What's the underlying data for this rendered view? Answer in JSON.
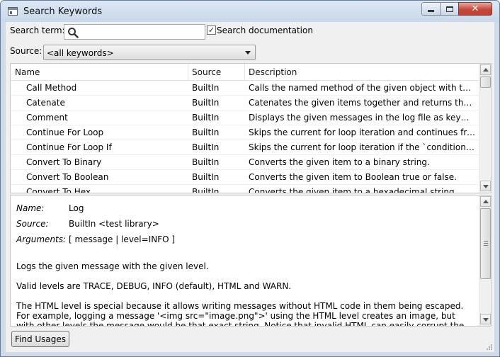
{
  "window": {
    "title": "Search Keywords"
  },
  "search": {
    "term_label": "Search term:",
    "term_value": "",
    "search_docs_label": "Search documentation",
    "search_docs_checked": true,
    "source_label": "Source:",
    "source_value": "<all keywords>"
  },
  "table": {
    "columns": [
      "Name",
      "Source",
      "Description"
    ],
    "rows": [
      {
        "name": "Call Method",
        "source": "BuiltIn",
        "description": "Calls the named method of the given object with the ..."
      },
      {
        "name": "Catenate",
        "source": "BuiltIn",
        "description": "Catenates the given items together and returns the r..."
      },
      {
        "name": "Comment",
        "source": "BuiltIn",
        "description": "Displays the given messages in the log file as keywor..."
      },
      {
        "name": "Continue For Loop",
        "source": "BuiltIn",
        "description": "Skips the current for loop iteration and continues fro..."
      },
      {
        "name": "Continue For Loop If",
        "source": "BuiltIn",
        "description": "Skips the current for loop iteration if the `condition` i..."
      },
      {
        "name": "Convert To Binary",
        "source": "BuiltIn",
        "description": "Converts the given item to a binary string."
      },
      {
        "name": "Convert To Boolean",
        "source": "BuiltIn",
        "description": "Converts the given item to Boolean true or false."
      },
      {
        "name": "Convert To Hex",
        "source": "BuiltIn",
        "description": "Converts the given item to a hexadecimal string."
      }
    ]
  },
  "detail": {
    "name_label": "Name:",
    "name_value": "Log",
    "source_label": "Source:",
    "source_value": "BuiltIn <test library>",
    "arguments_label": "Arguments:",
    "arguments_value": "[ message | level=INFO ]",
    "paragraphs": [
      "Logs the given message with the given level.",
      "Valid levels are TRACE, DEBUG, INFO (default), HTML and WARN.",
      "The HTML level is special because it allows writing messages without HTML code in them being escaped. For example, logging a message '<img src=\"image.png\">' using the HTML level creates an image, but with other levels the message would be that exact string. Notice that invalid HTML can easily corrupt the whole log file so this"
    ]
  },
  "buttons": {
    "find_usages": "Find Usages"
  },
  "icons": {
    "search": "search-icon",
    "minimize": "minimize-icon",
    "maximize": "maximize-icon",
    "close": "close-icon",
    "dropdown": "chevron-down-icon"
  },
  "colors": {
    "frame": "#cfdbe9",
    "close_button": "#c7483a",
    "panel": "#f0f0f0"
  }
}
